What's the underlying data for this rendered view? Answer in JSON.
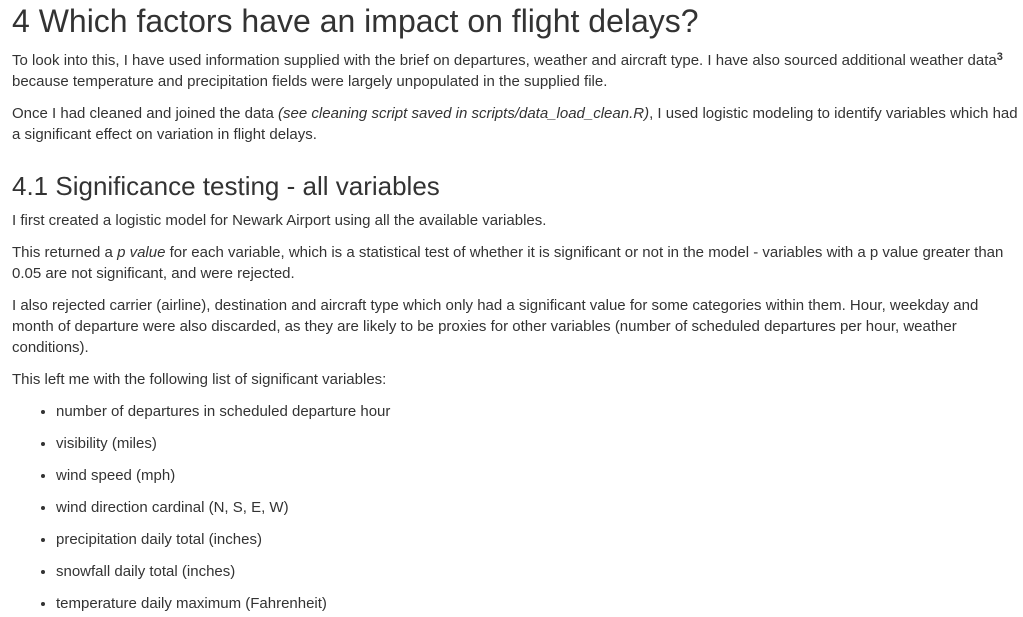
{
  "section4": {
    "heading": "4 Which factors have an impact on flight delays?",
    "p1_before_sup": "To look into this, I have used information supplied with the brief on departures, weather and aircraft type. I have also sourced additional weather data",
    "p1_footnote": "3",
    "p1_after_sup": " because temperature and precipitation fields were largely unpopulated in the supplied file.",
    "p2_before_em": "Once I had cleaned and joined the data ",
    "p2_em": "(see cleaning script saved in scripts/data_load_clean.R)",
    "p2_after_em": ", I used logistic modeling to identify variables which had a significant effect on variation in flight delays."
  },
  "section41": {
    "heading": "4.1 Significance testing - all variables",
    "p1": "I first created a logistic model for Newark Airport using all the available variables.",
    "p2_before_em": "This returned a ",
    "p2_em": "p value",
    "p2_after_em": " for each variable, which is a statistical test of whether it is significant or not in the model - variables with a p value greater than 0.05 are not significant, and were rejected.",
    "p3": "I also rejected carrier (airline), destination and aircraft type which only had a significant value for some categories within them. Hour, weekday and month of departure were also discarded, as they are likely to be proxies for other variables (number of scheduled departures per hour, weather conditions).",
    "p4": "This left me with the following list of significant variables:",
    "variables": [
      "number of departures in scheduled departure hour",
      "visibility (miles)",
      "wind speed (mph)",
      "wind direction cardinal (N, S, E, W)",
      "precipitation daily total (inches)",
      "snowfall daily total (inches)",
      "temperature daily maximum (Fahrenheit)"
    ]
  }
}
